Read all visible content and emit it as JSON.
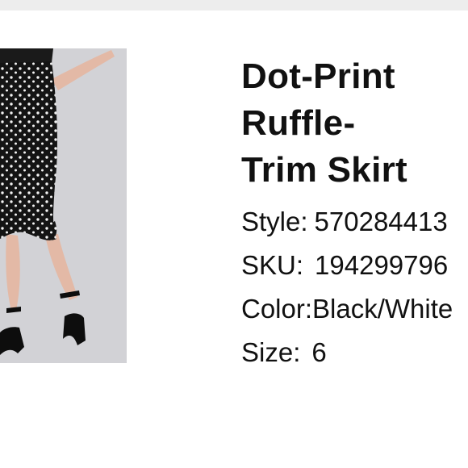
{
  "product": {
    "title": "Dot-Print Ruffle-\nTrim Skirt",
    "attributes": {
      "style": {
        "label": "Style:",
        "value": "570284413"
      },
      "sku": {
        "label": "SKU:",
        "value": "194299796"
      },
      "color": {
        "label": "Color:",
        "value": "Black/White"
      },
      "size": {
        "label": "Size:",
        "value": "6"
      }
    },
    "image": {
      "skirt_color": "#141414",
      "dot_color": "#f2f2f2",
      "background_color": "#d2d2d6",
      "skin_color": "#e3b9a6"
    }
  }
}
